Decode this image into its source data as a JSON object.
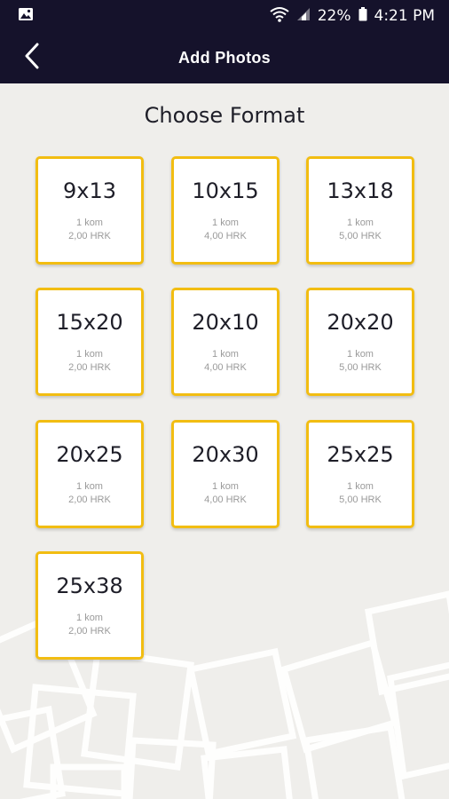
{
  "status_bar": {
    "battery": "22%",
    "time": "4:21 PM",
    "icons": [
      "image-icon",
      "wifi-icon",
      "signal-icon",
      "battery-icon"
    ]
  },
  "app_bar": {
    "title": "Add Photos",
    "back_icon": "chevron-left-icon"
  },
  "main": {
    "heading": "Choose Format",
    "formats": [
      {
        "size": "9x13",
        "qty": "1 kom",
        "price": "2,00 HRK"
      },
      {
        "size": "10x15",
        "qty": "1 kom",
        "price": "4,00 HRK"
      },
      {
        "size": "13x18",
        "qty": "1 kom",
        "price": "5,00 HRK"
      },
      {
        "size": "15x20",
        "qty": "1 kom",
        "price": "2,00 HRK"
      },
      {
        "size": "20x10",
        "qty": "1 kom",
        "price": "4,00 HRK"
      },
      {
        "size": "20x20",
        "qty": "1 kom",
        "price": "5,00 HRK"
      },
      {
        "size": "20x25",
        "qty": "1 kom",
        "price": "2,00 HRK"
      },
      {
        "size": "20x30",
        "qty": "1 kom",
        "price": "4,00 HRK"
      },
      {
        "size": "25x25",
        "qty": "1 kom",
        "price": "5,00 HRK"
      },
      {
        "size": "25x38",
        "qty": "1 kom",
        "price": "2,00 HRK"
      }
    ]
  },
  "colors": {
    "header_bg": "#15122b",
    "accent": "#f2bd12",
    "page_bg": "#efeeeb"
  }
}
